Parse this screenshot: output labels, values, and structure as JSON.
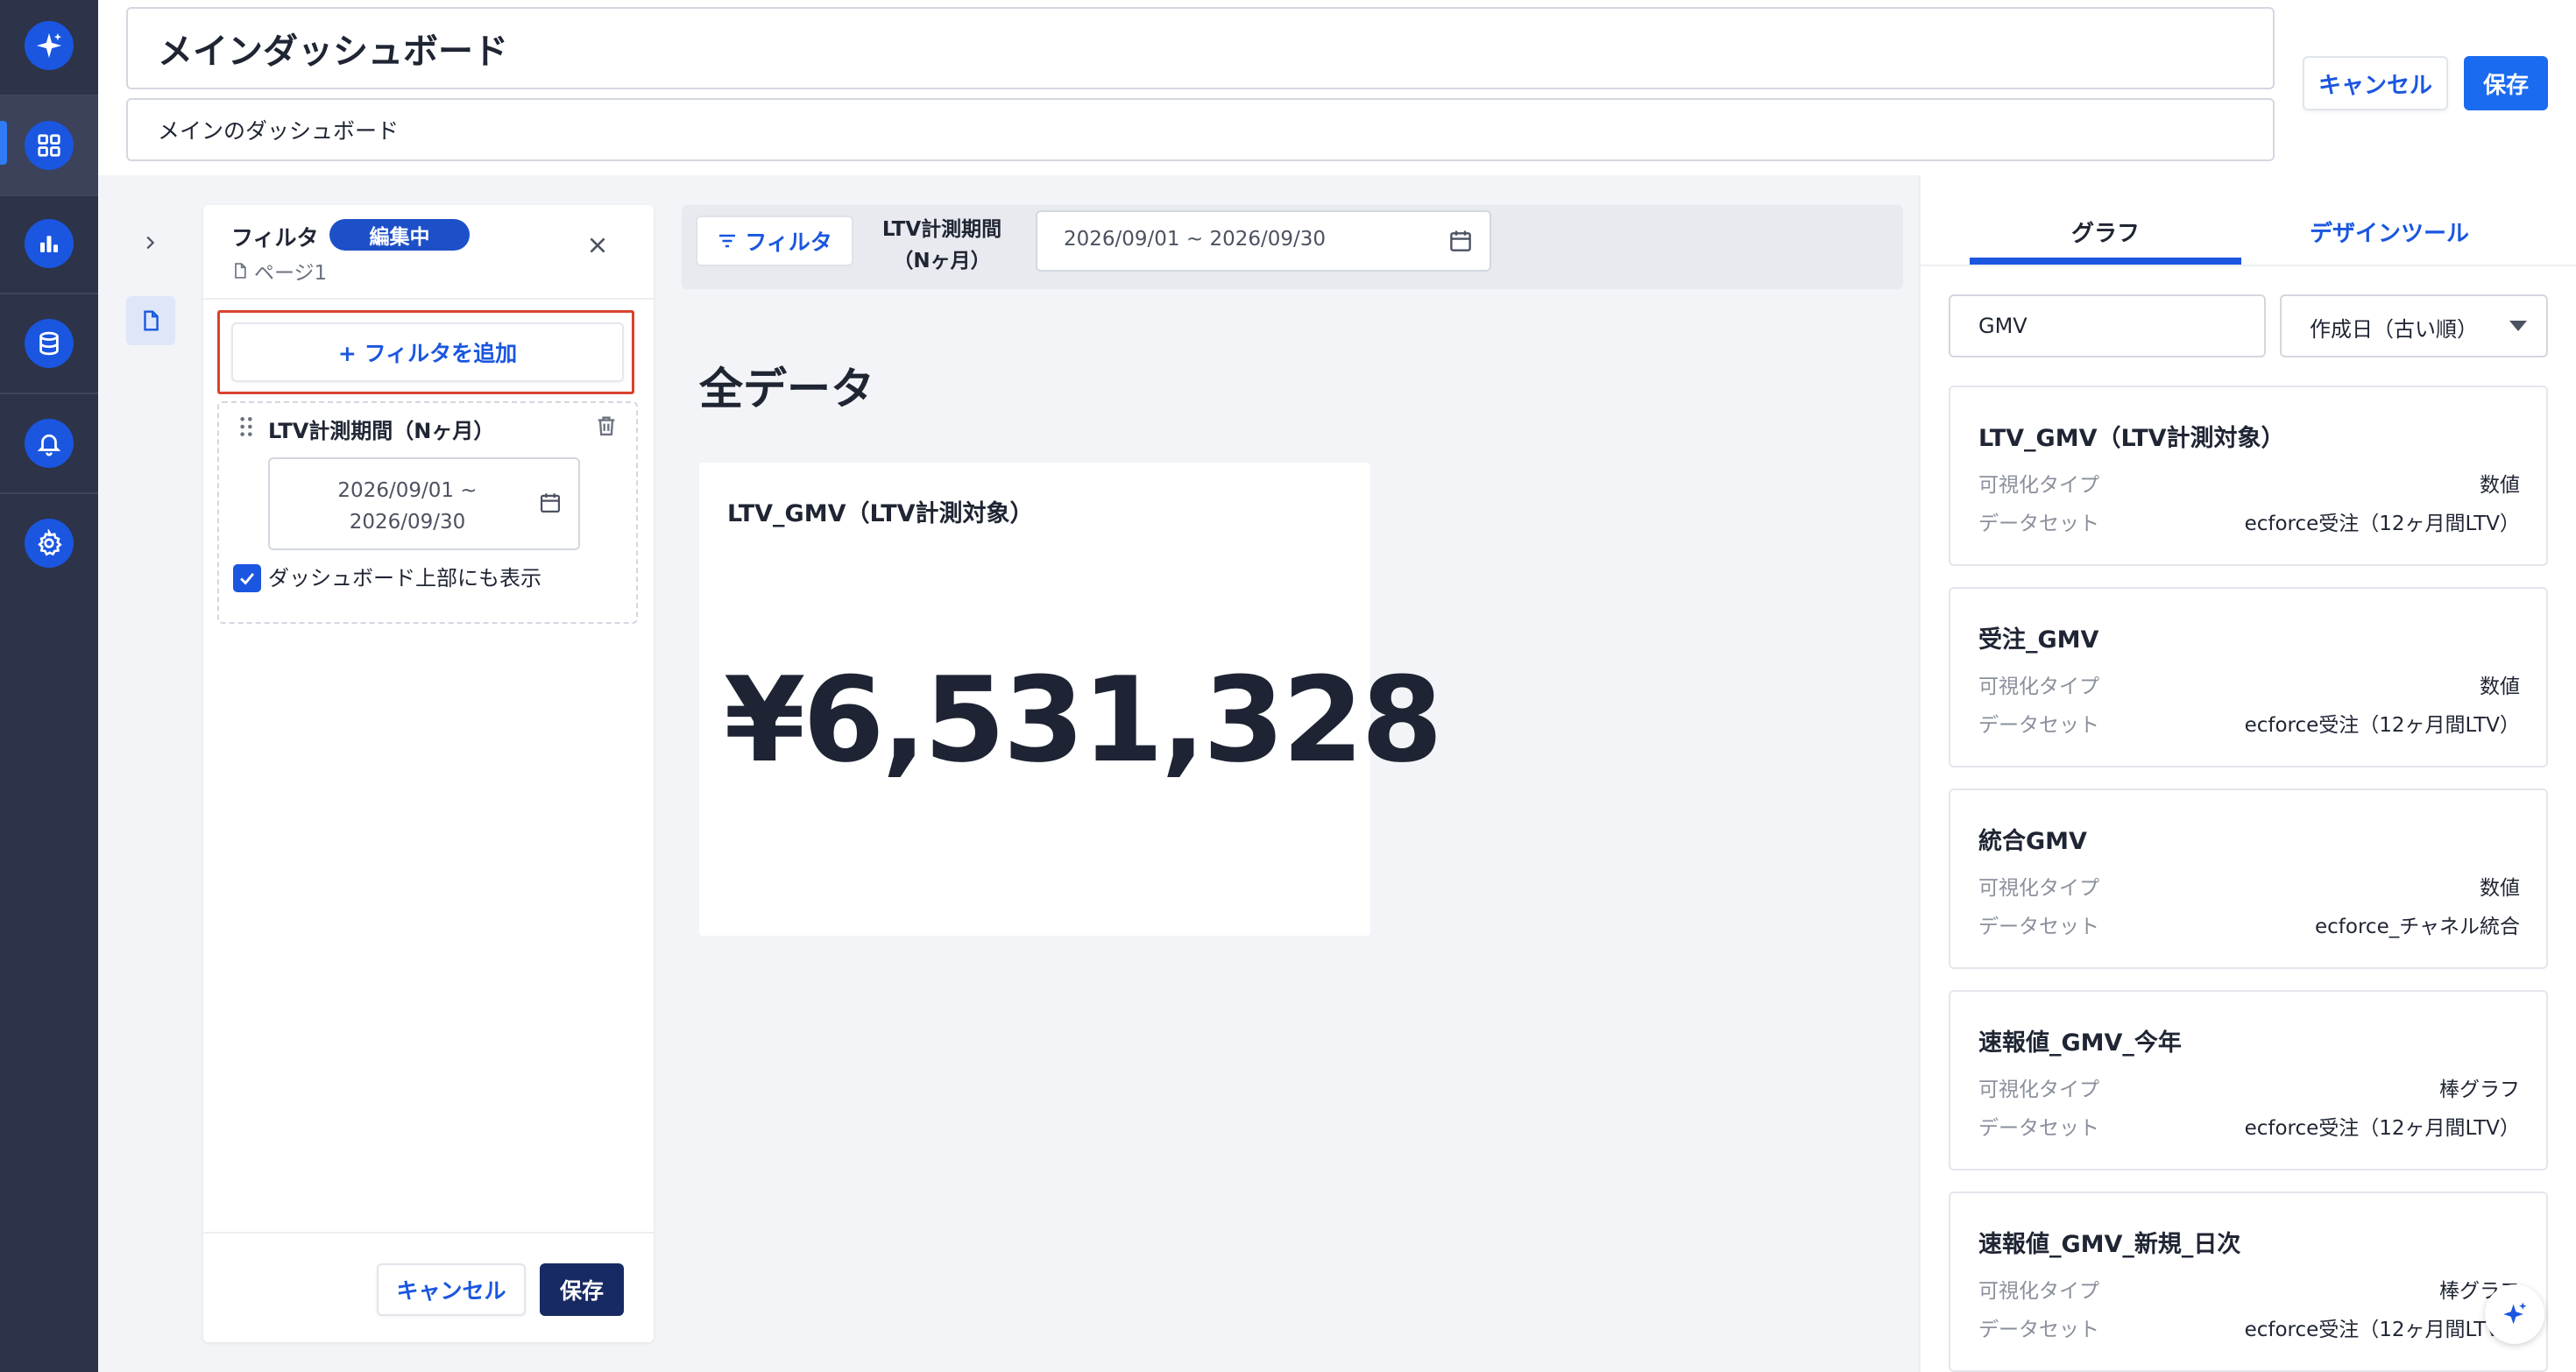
{
  "header": {
    "title": "メインダッシュボード",
    "description": "メインのダッシュボード",
    "cancel_label": "キャンセル",
    "save_label": "保存"
  },
  "nav": {
    "icons": [
      "sparkle-logo-icon",
      "dashboard-grid-icon",
      "bar-chart-icon",
      "database-icon",
      "bell-icon",
      "gear-icon"
    ],
    "active": "dashboard-grid-icon",
    "accent": "#1a56e0"
  },
  "filter_panel": {
    "title": "フィルタ",
    "badge": "編集中",
    "page": "ページ1",
    "add_filter_label": "+ フィルタを追加",
    "item": {
      "label": "LTV計測期間（Nヶ月）",
      "date_line1": "2026/09/01 ~",
      "date_line2": "2026/09/30",
      "checkbox_label": "ダッシュボード上部にも表示",
      "checked": true
    },
    "cancel_label": "キャンセル",
    "save_label": "保存"
  },
  "canvas": {
    "filter_button_label": "フィルタ",
    "filter_label_line1": "LTV計測期間",
    "filter_label_line2": "（Nヶ月）",
    "date_range": "2026/09/01 ~ 2026/09/30",
    "section_title": "全データ",
    "metric": {
      "title": "LTV_GMV（LTV計測対象）",
      "value": "¥6,531,328"
    }
  },
  "library": {
    "tabs": [
      "グラフ",
      "デザインツール"
    ],
    "active_tab": "グラフ",
    "search_value": "GMV",
    "sort_value": "作成日（古い順）",
    "type_key": "可視化タイプ",
    "dataset_key": "データセット",
    "cards": [
      {
        "name": "LTV_GMV（LTV計測対象）",
        "type": "数値",
        "dataset": "ecforce受注（12ヶ月間LTV）"
      },
      {
        "name": "受注_GMV",
        "type": "数値",
        "dataset": "ecforce受注（12ヶ月間LTV）"
      },
      {
        "name": "統合GMV",
        "type": "数値",
        "dataset": "ecforce_チャネル統合"
      },
      {
        "name": "速報値_GMV_今年",
        "type": "棒グラフ",
        "dataset": "ecforce受注（12ヶ月間LTV）"
      },
      {
        "name": "速報値_GMV_新規_日次",
        "type": "棒グラフ",
        "dataset": "ecforce受注（12ヶ月間LTV）"
      }
    ]
  }
}
